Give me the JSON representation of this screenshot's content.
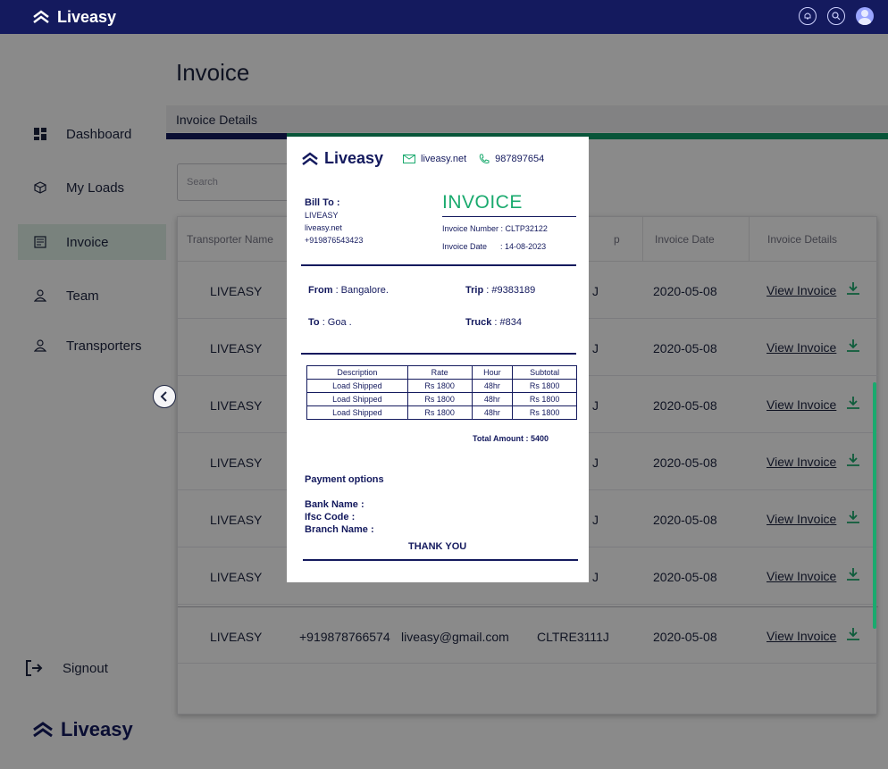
{
  "app": {
    "brand": "Liveasy",
    "colors": {
      "navy": "#141a5e",
      "green": "#1aaa6e",
      "active_bg": "#dff1e8"
    }
  },
  "topbar": {
    "icons": [
      "bell-icon",
      "search-icon",
      "user-avatar"
    ]
  },
  "sidebar": {
    "items": [
      {
        "label": "Dashboard",
        "icon": "dashboard-icon"
      },
      {
        "label": "My Loads",
        "icon": "box-icon"
      },
      {
        "label": "Invoice",
        "icon": "invoice-icon",
        "active": true
      },
      {
        "label": "Team",
        "icon": "person-icon"
      },
      {
        "label": "Transporters",
        "icon": "person-icon"
      }
    ],
    "signout": "Signout",
    "bottom_brand": "Liveasy"
  },
  "main": {
    "title": "Invoice",
    "section_title": "Invoice Details",
    "search_placeholder": "Search",
    "table": {
      "headers": [
        "Transporter Name",
        "p",
        "Invoice Date",
        "Invoice Details"
      ],
      "rows": [
        {
          "name": "LIVEASY",
          "phone": "",
          "email": "",
          "id_tail": "J",
          "date": "2020-05-08",
          "link": "View Invoice"
        },
        {
          "name": "LIVEASY",
          "phone": "",
          "email": "",
          "id_tail": "J",
          "date": "2020-05-08",
          "link": "View Invoice"
        },
        {
          "name": "LIVEASY",
          "phone": "",
          "email": "",
          "id_tail": "J",
          "date": "2020-05-08",
          "link": "View Invoice"
        },
        {
          "name": "LIVEASY",
          "phone": "",
          "email": "",
          "id_tail": "J",
          "date": "2020-05-08",
          "link": "View Invoice"
        },
        {
          "name": "LIVEASY",
          "phone": "",
          "email": "",
          "id_tail": "J",
          "date": "2020-05-08",
          "link": "View Invoice"
        },
        {
          "name": "LIVEASY",
          "phone": "",
          "email": "",
          "id_tail": "J",
          "date": "2020-05-08",
          "link": "View Invoice"
        },
        {
          "name": "LIVEASY",
          "phone": "+919878766574",
          "email": "liveasy@gmail.com",
          "id_tail": "CLTRE3111J",
          "date": "2020-05-08",
          "link": "View Invoice"
        }
      ]
    }
  },
  "invoice": {
    "brand": "Liveasy",
    "website": "liveasy.net",
    "phone": "987897654",
    "bill_to_label": "Bill To :",
    "bill_to": [
      "LIVEASY",
      "liveasy.net",
      "+919876543423"
    ],
    "title": "INVOICE",
    "invoice_number_label": "Invoice Number :",
    "invoice_number": "CLTP32122",
    "invoice_date_label": "Invoice Date",
    "invoice_date": ": 14-08-2023",
    "from_label": "From",
    "from": ": Bangalore.",
    "to_label": "To",
    "to": ": Goa .",
    "trip_label": "Trip",
    "trip": ": #9383189",
    "truck_label": "Truck",
    "truck": ": #834",
    "items_headers": [
      "Description",
      "Rate",
      "Hour",
      "Subtotal"
    ],
    "items": [
      [
        "Load Shipped",
        "Rs 1800",
        "48hr",
        "Rs 1800"
      ],
      [
        "Load Shipped",
        "Rs 1800",
        "48hr",
        "Rs 1800"
      ],
      [
        "Load Shipped",
        "Rs 1800",
        "48hr",
        "Rs 1800"
      ]
    ],
    "total": "Total Amount : 5400",
    "payment_heading": "Payment options",
    "bank_name": "Bank Name   :",
    "ifsc_code": "Ifsc Code      :",
    "branch_name": "Branch Name :",
    "thanks": "THANK YOU"
  }
}
